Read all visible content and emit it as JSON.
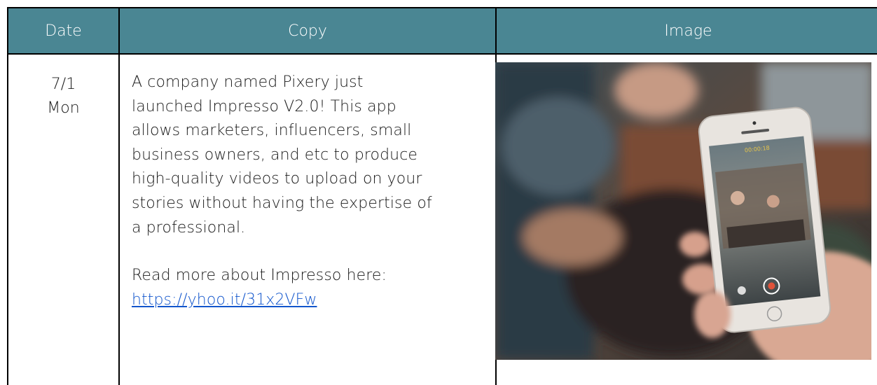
{
  "headers": {
    "date": "Date",
    "copy": "Copy",
    "image": "Image"
  },
  "row": {
    "date_line1": "7/1",
    "date_line2": "Mon",
    "copy_lines": [
      "A company named Pixery just",
      "launched Impresso V2.0! This app",
      "allows marketers, influencers, small",
      "business owners, and etc to produce",
      "high-quality videos to upload on your",
      "stories without having the expertise of",
      "a professional."
    ],
    "read_more": "Read more about Impresso here:",
    "link": "https://yhoo.it/31x2VFw",
    "phone_timer": "00:00:18"
  },
  "colors": {
    "header_bg": "#4a8693",
    "link": "#1155cc"
  }
}
